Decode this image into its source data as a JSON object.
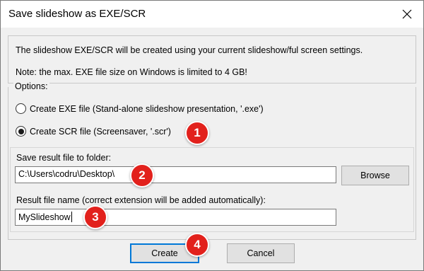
{
  "window": {
    "title": "Save slideshow as EXE/SCR"
  },
  "info": {
    "line1": "The slideshow EXE/SCR will be created using your current slideshow/ful screen settings.",
    "line2": "Note: the max. EXE file size on Windows is limited to 4 GB!"
  },
  "options": {
    "label": "Options:",
    "radios": [
      {
        "label": "Create EXE file (Stand-alone slideshow presentation, '.exe')",
        "selected": false
      },
      {
        "label": "Create SCR file (Screensaver, '.scr')",
        "selected": true
      }
    ]
  },
  "folder": {
    "label": "Save result file to folder:",
    "value": "C:\\Users\\codru\\Desktop\\",
    "browse_label": "Browse"
  },
  "filename": {
    "label": "Result file name (correct extension will be added automatically):",
    "value": "MySlideshow"
  },
  "buttons": {
    "create": "Create",
    "cancel": "Cancel"
  },
  "badges": [
    "1",
    "2",
    "3",
    "4"
  ],
  "colors": {
    "badge": "#e2211c",
    "default_button_border": "#0078d7"
  }
}
